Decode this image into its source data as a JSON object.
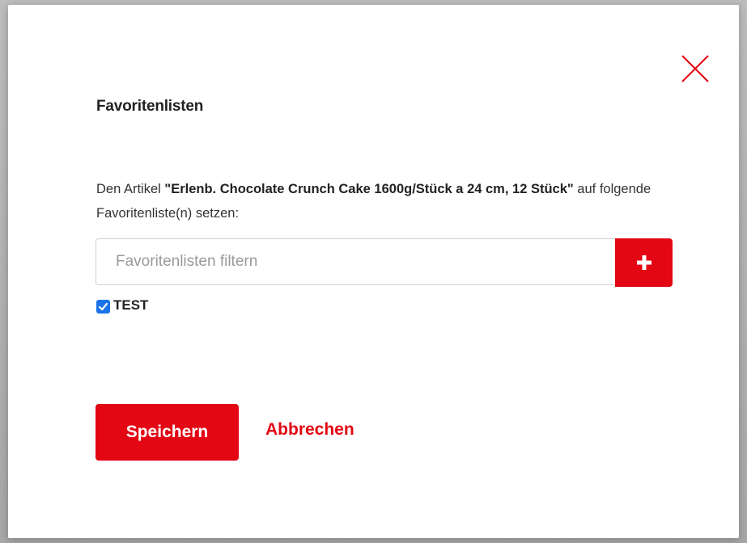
{
  "colors": {
    "accent": "#e30613",
    "checkbox": "#1a73e8",
    "text": "#222222"
  },
  "dialog": {
    "close_icon": "close-icon",
    "title": "Favoritenlisten",
    "description": {
      "prefix": "Den Artikel ",
      "article": "\"Erlenb. Chocolate Crunch Cake 1600g/Stück a 24 cm, 12 Stück\"",
      "suffix": " auf folgende Favoritenliste(n) setzen:"
    },
    "filter": {
      "value": "",
      "placeholder": "Favoritenlisten filtern",
      "add_icon": "plus-icon"
    },
    "lists": [
      {
        "label": "TEST",
        "checked": true
      }
    ],
    "actions": {
      "save_label": "Speichern",
      "cancel_label": "Abbrechen"
    }
  }
}
